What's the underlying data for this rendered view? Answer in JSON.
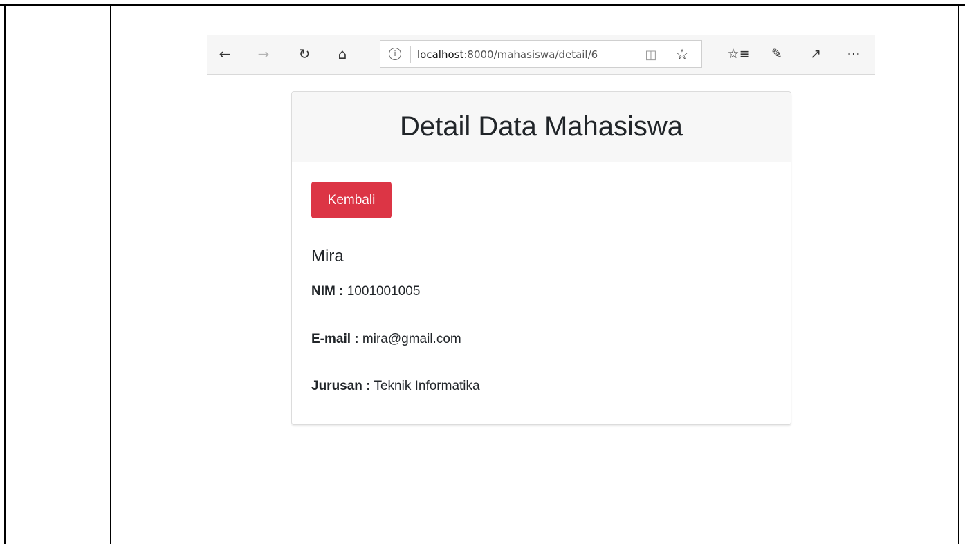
{
  "browser": {
    "address": {
      "host": "localhost",
      "path": ":8000/mahasiswa/detail/6"
    },
    "icons": {
      "back": "back-arrow-icon",
      "forward": "forward-arrow-icon",
      "refresh": "refresh-icon",
      "home": "home-icon",
      "info": "info-icon",
      "reading_view": "reading-view-icon",
      "favorite": "star-icon",
      "favorites_list": "favorites-list-icon",
      "notes": "pen-icon",
      "share": "share-icon",
      "more": "more-icon"
    }
  },
  "card": {
    "title": "Detail Data Mahasiswa",
    "back_button": "Kembali",
    "name": "Mira",
    "fields": [
      {
        "label": "NIM :",
        "value": "1001001005"
      },
      {
        "label": "E-mail :",
        "value": "mira@gmail.com"
      },
      {
        "label": "Jurusan :",
        "value": "Teknik Informatika"
      }
    ]
  },
  "colors": {
    "danger": "#dc3545",
    "card_header": "#f7f7f7",
    "toolbar": "#f6f6f6"
  }
}
